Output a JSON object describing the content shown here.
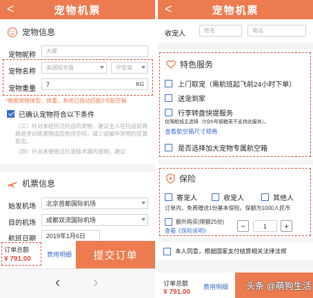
{
  "left": {
    "header": {
      "title": "宠物机票",
      "back": "<"
    },
    "pet": {
      "section_title": "宠物信息",
      "nickname_label": "宠物昵称",
      "nickname_value": "大椰",
      "name_label": "宠物名称",
      "name_value": "美国短毛猫",
      "size_value": "中型猫",
      "weight_label": "宠物重量",
      "weight_value": "7",
      "weight_unit": "KG",
      "hint": "*根据宠物体型、体重，系统已自动匹配2号航空箱",
      "confirm_label": "已确认宠物符合以下条件",
      "cond1": "（三）针对未经历过托运的宠物，建议主人在托运前两周逐步训练宠物适应密闭空间，减少运输中宠物的应激反应。",
      "cond2": "（四）针对未使用过打滚技术器的宠物，建议"
    },
    "ticket": {
      "section_title": "机票信息",
      "from_label": "始发机场",
      "from_value": "北京首都国际机场",
      "to_label": "目的机场",
      "to_value": "成都双流国际机场",
      "date_label": "航班日期",
      "date_value": "2019年1月6日"
    },
    "footer": {
      "total_label": "订单总额",
      "total_value": "¥ 791.00",
      "detail_label": "费用明细",
      "submit_label": "提交订单"
    },
    "nav": {
      "back": "‹",
      "forward": "›"
    }
  },
  "right": {
    "header": {
      "title": "宠物机票",
      "back": "<"
    },
    "receiver": {
      "label": "收宠人",
      "name_placeholder": "姓名",
      "phone_placeholder": "电话"
    },
    "services": {
      "section_title": "特色服务",
      "pickup": "上门取宠（需航班起飞前24小时下单）",
      "delivery": "送宠到家",
      "carousel": "行李转盘快提服务",
      "carousel_note": "仅限航线主选择（5交6号钢箱笼不支持此服务）。",
      "crate_link": "查看航空箱尺寸规格",
      "big_crate": "是否选择加大宠物专属航空箱"
    },
    "insurance": {
      "section_title": "保险",
      "opt_sender": "寄宠人",
      "opt_receiver": "收宠人",
      "opt_other": "其他人",
      "desc": "订单内，免费赠送1份基本保险。保额为1000人民币",
      "extra": "额外购买(限额25份)",
      "terms_link": "查看《保险说明》",
      "qty": "1",
      "minus": "−",
      "plus": "+"
    },
    "agree": "本人同意，根据国家支付结算相关法律法规",
    "footer": {
      "total_label": "订单总额",
      "total_value": "¥ 791.00",
      "detail_label": "费用明细"
    },
    "watermark": "头条 @萌狗生活"
  },
  "colors": {
    "accent": "#ec7b4f",
    "highlight_border": "#e04a3a",
    "checkbox": "#3a6cc8"
  }
}
